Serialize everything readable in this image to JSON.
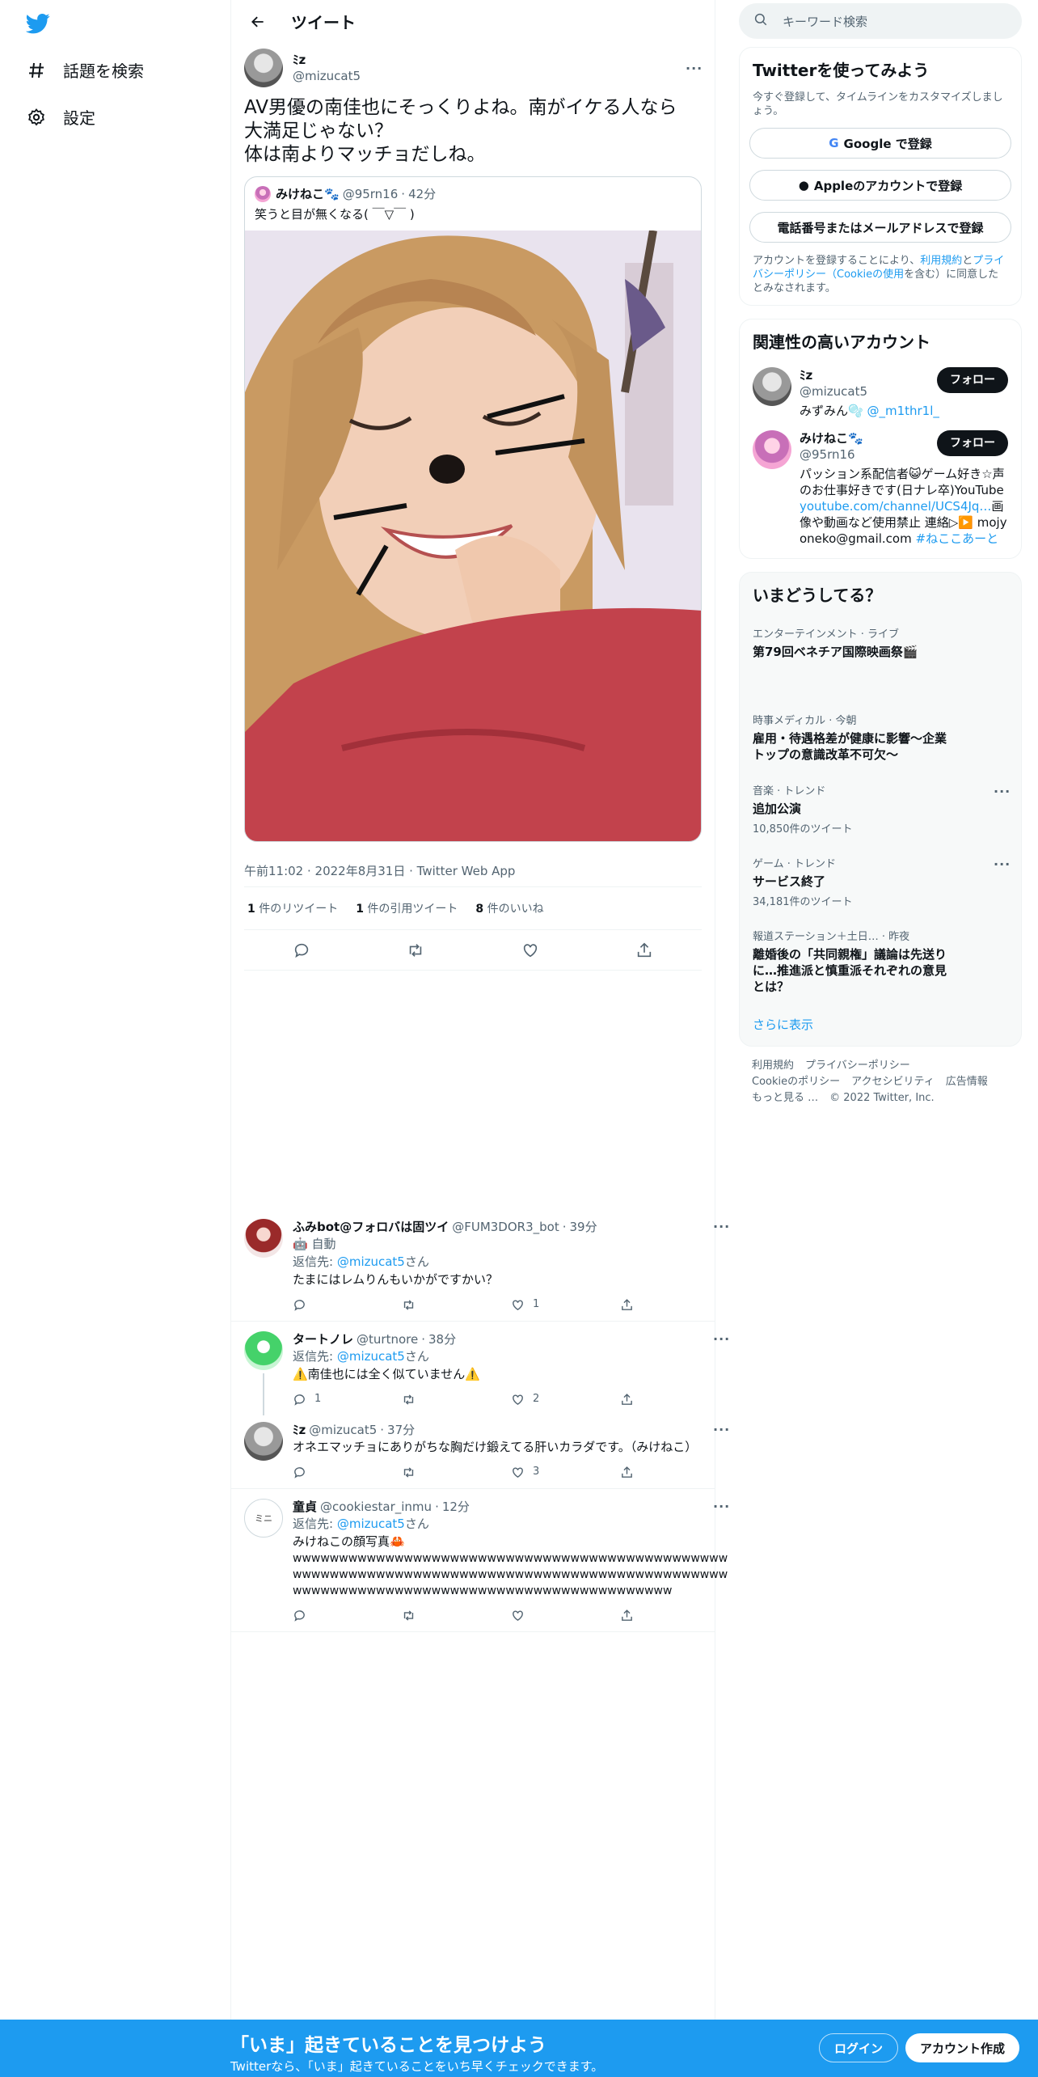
{
  "nav": {
    "explore": "話題を検索",
    "settings": "設定"
  },
  "header": {
    "title": "ツイート"
  },
  "tweet": {
    "name": "ﾐz",
    "handle": "@mizucat5",
    "lines": [
      "AV男優の南佳也にそっくりよね。南がイケる人なら",
      "大満足じゃない？",
      "体は南よりマッチョだしね。"
    ],
    "quote": {
      "name": "みけねこ🐾",
      "handle": "@95rn16",
      "time": "42分",
      "text": "笑うと目が無くなる( ￣▽￣ )"
    },
    "meta": "午前11:02 · 2022年8月31日 · Twitter Web App",
    "retweets": "1",
    "retweets_label": "件のリツイート",
    "quotes": "1",
    "quotes_label": "件の引用ツイート",
    "likes": "8",
    "likes_label": "件のいいね"
  },
  "replies": [
    {
      "name": "ふみbot@フォロバは固ツイ",
      "handle": "@FUM3DOR3_bot",
      "time": "39分",
      "auto": "自動",
      "to_prefix": "返信先: ",
      "to": "@mizucat5",
      "to_suffix": "さん",
      "text": "たまにはレムりんもいかがですかい？",
      "reply_count": "",
      "rt_count": "",
      "like_count": "1"
    },
    {
      "name": "タートノレ",
      "handle": "@turtnore",
      "time": "38分",
      "to_prefix": "返信先: ",
      "to": "@mizucat5",
      "to_suffix": "さん",
      "text": "⚠️南佳也には全く似ていません⚠️",
      "reply_count": "1",
      "rt_count": "",
      "like_count": "2"
    },
    {
      "name": "ﾐz",
      "handle": "@mizucat5",
      "time": "37分",
      "text": "オネエマッチョにありがちな胸だけ鍛えてる肝いカラダです。（みけねこ）",
      "reply_count": "",
      "rt_count": "",
      "like_count": "3"
    },
    {
      "name": "童貞",
      "handle": "@cookiestar_inmu",
      "time": "12分",
      "to_prefix": "返信先: ",
      "to": "@mizucat5",
      "to_suffix": "さん",
      "text": "みけねこの顔写真🦀",
      "text2": "wwwwwwwwwwwwwwwwwwwwwwwwwwwwwwwwwwwwwwwwwwwwwwwwwwwwwwwwwwwwwwwwwwwwwwwwwwwwwwwwwwwwwwwwwwwwwwwwwwwwwwwwwwwwwwwwwwwwwwwwwwwwwwwwwwwwwww",
      "reply_count": "",
      "rt_count": "",
      "like_count": ""
    }
  ],
  "sidebar": {
    "search_placeholder": "キーワード検索",
    "signup_title": "Twitterを使ってみよう",
    "signup_sub": "今すぐ登録して、タイムラインをカスタマイズしましょう。",
    "btn_google": "Google で登録",
    "btn_apple": "Appleのアカウントで登録",
    "btn_phone": "電話番号またはメールアドレスで登録",
    "terms_pre": "アカウントを登録することにより、",
    "terms_link1": "利用規約",
    "terms_mid": "と",
    "terms_link2": "プライバシーポリシー（Cookieの使用",
    "terms_post": "を含む）に同意したとみなされます。",
    "related_title": "関連性の高いアカウント",
    "follow": "フォロー",
    "acc1": {
      "name": "ﾐz",
      "handle": "@mizucat5",
      "bio": "みずみん🫧",
      "bio_link": "@_m1thr1l_"
    },
    "acc2": {
      "name": "みけねこ🐾",
      "handle": "@95rn16",
      "bio1": "パッション系配信者😺ゲーム好き☆声のお仕事好きです(日ナレ卒)YouTube",
      "bio_link": "youtube.com/channel/UCS4Jq…",
      "bio2": "画像や動画など使用禁止 連絡▷▶️ mojyoneko@gmail.com",
      "bio_tag": "#ねここあーと"
    },
    "trends_title": "いまどうしてる？",
    "trends": [
      {
        "cat": "エンターテインメント · ライブ",
        "title": "第79回ベネチア国際映画祭🎬",
        "count": ""
      },
      {
        "cat": "時事メディカル · 今朝",
        "title": "雇用・待遇格差が健康に影響～企業トップの意識改革不可欠～",
        "count": ""
      },
      {
        "cat": "音楽 · トレンド",
        "title": "追加公演",
        "count": "10,850件のツイート"
      },
      {
        "cat": "ゲーム · トレンド",
        "title": "サービス終了",
        "count": "34,181件のツイート"
      },
      {
        "cat": "報道ステーション＋土日… · 昨夜",
        "title": "離婚後の「共同親権」議論は先送りに…推進派と慎重派それぞれの意見とは？",
        "count": ""
      }
    ],
    "show_more": "さらに表示",
    "footer": [
      "利用規約",
      "プライバシーポリシー",
      "Cookieのポリシー",
      "アクセシビリティ",
      "広告情報",
      "もっと見る …",
      "© 2022 Twitter, Inc."
    ]
  },
  "banner": {
    "title": "「いま」起きていることを見つけよう",
    "sub": "Twitterなら、「いま」起きていることをいち早くチェックできます。",
    "login": "ログイン",
    "signup": "アカウント作成"
  },
  "colors": {
    "accent": "#1d9bf0",
    "text": "#0f1419",
    "muted": "#536471"
  }
}
